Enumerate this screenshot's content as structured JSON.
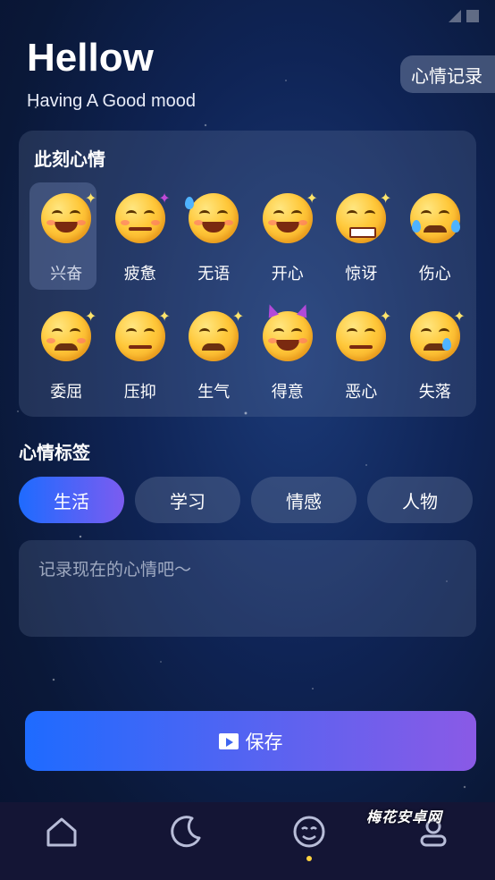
{
  "header": {
    "title": "Hellow",
    "subtitle": "Having A Good mood",
    "record_button": "心情记录"
  },
  "mood_section": {
    "title": "此刻心情",
    "selected_index": 0,
    "moods": [
      {
        "label": "兴奋",
        "icon": "grinning-squint-sparkle-icon"
      },
      {
        "label": "疲惫",
        "icon": "tired-face-icon"
      },
      {
        "label": "无语",
        "icon": "sweat-smile-icon"
      },
      {
        "label": "开心",
        "icon": "happy-squint-icon"
      },
      {
        "label": "惊讶",
        "icon": "grimace-surprised-icon"
      },
      {
        "label": "伤心",
        "icon": "crying-face-icon"
      },
      {
        "label": "委屈",
        "icon": "pleading-face-icon"
      },
      {
        "label": "压抑",
        "icon": "sneezing-face-icon"
      },
      {
        "label": "生气",
        "icon": "angry-steam-face-icon"
      },
      {
        "label": "得意",
        "icon": "smiling-devil-icon"
      },
      {
        "label": "恶心",
        "icon": "rolling-eyes-face-icon"
      },
      {
        "label": "失落",
        "icon": "disappointed-sweat-face-icon"
      }
    ]
  },
  "tags_section": {
    "title": "心情标签",
    "tags": [
      {
        "label": "生活",
        "active": true
      },
      {
        "label": "学习",
        "active": false
      },
      {
        "label": "情感",
        "active": false
      },
      {
        "label": "人物",
        "active": false
      }
    ]
  },
  "note": {
    "placeholder": "记录现在的心情吧～",
    "value": ""
  },
  "save_button": {
    "label": "保存",
    "icon": "clapperboard-icon"
  },
  "tabbar": {
    "items": [
      {
        "icon": "home-icon"
      },
      {
        "icon": "moon-icon"
      },
      {
        "icon": "smile-face-icon",
        "active": true
      },
      {
        "icon": "profile-icon"
      }
    ]
  },
  "watermark": "梅花安卓网",
  "colors": {
    "accent_start": "#1e6bff",
    "accent_end": "#8a5ae6",
    "active_dot": "#ffd23f"
  }
}
